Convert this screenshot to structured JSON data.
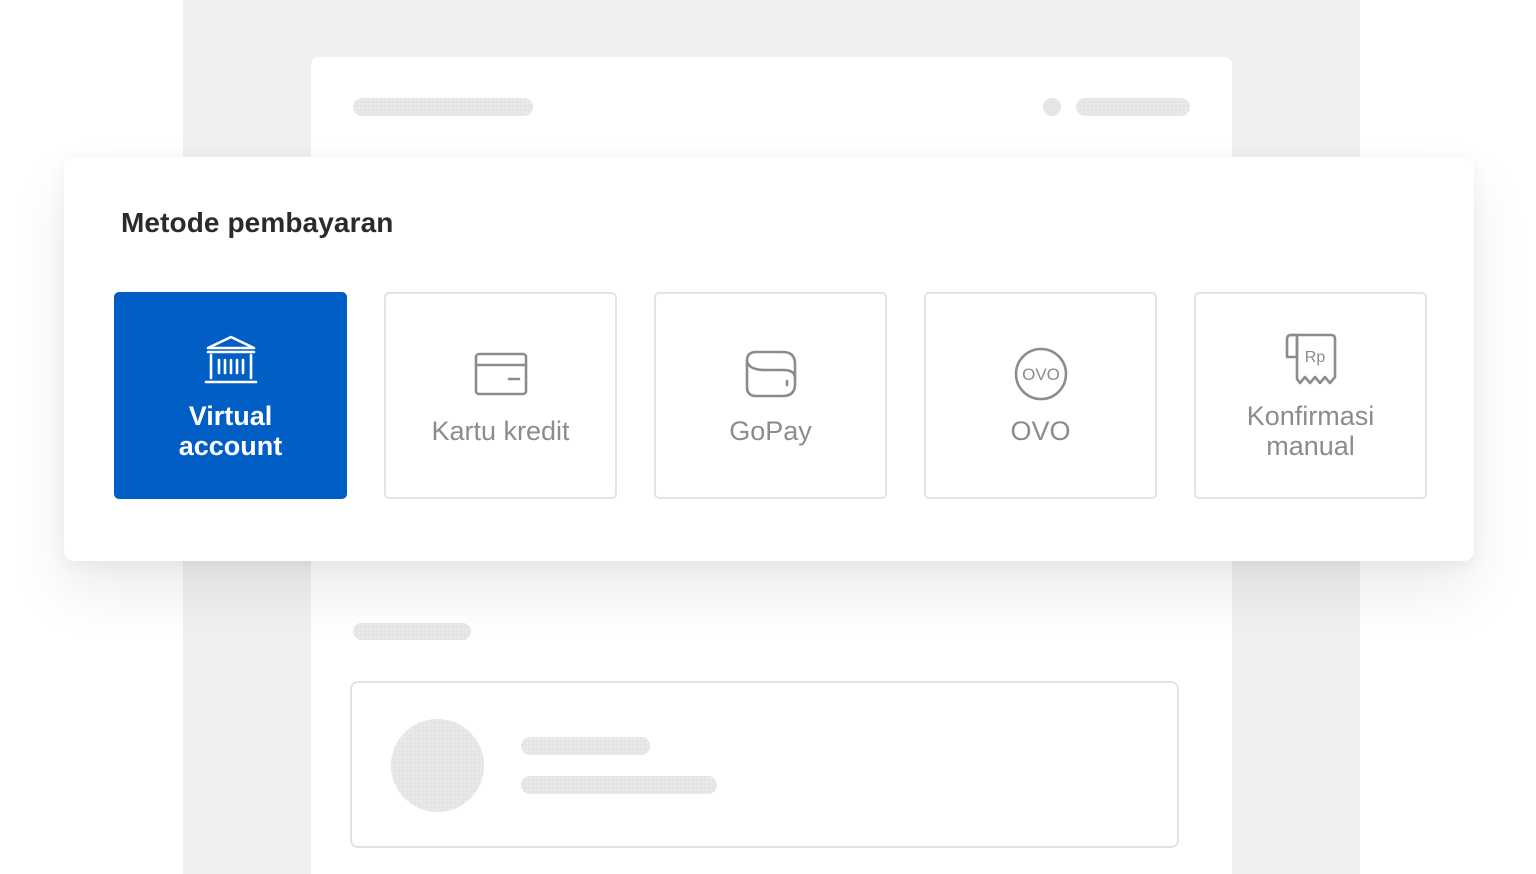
{
  "payment": {
    "title": "Metode pembayaran",
    "methods": [
      {
        "label": "Virtual\naccount",
        "icon": "bank-icon",
        "selected": true
      },
      {
        "label": "Kartu kredit",
        "icon": "credit-card-icon",
        "selected": false
      },
      {
        "label": "GoPay",
        "icon": "wallet-icon",
        "selected": false
      },
      {
        "label": "OVO",
        "icon": "ovo-icon",
        "icon_text": "OVO",
        "selected": false
      },
      {
        "label": "Konfirmasi\nmanual",
        "icon": "receipt-rp-icon",
        "icon_text": "Rp",
        "selected": false
      }
    ]
  },
  "colors": {
    "accent": "#005ec4",
    "text": "#2b2b2b",
    "muted": "#8a8c8e",
    "border": "#e3e4e5",
    "background": "#eff0f0"
  }
}
